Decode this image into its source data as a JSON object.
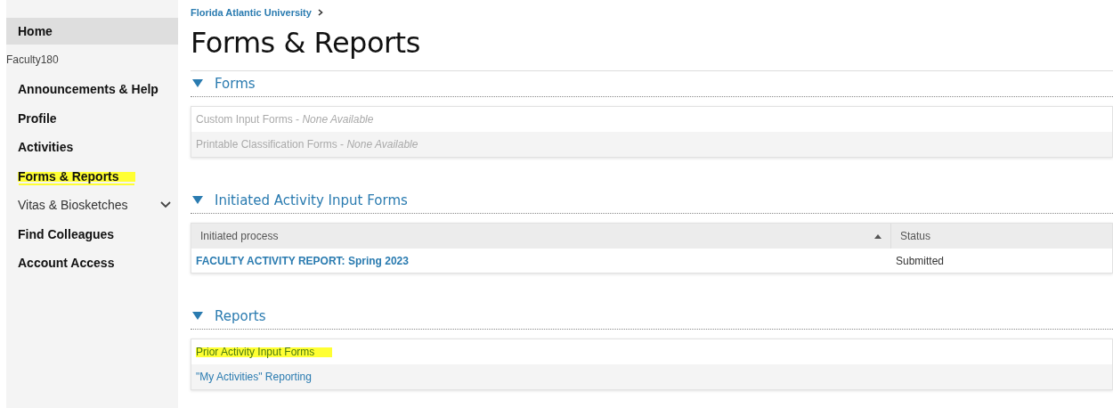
{
  "sidebar": {
    "items": [
      {
        "kind": "link",
        "label": "Home",
        "selected": true,
        "highlighted": false
      },
      {
        "kind": "heading",
        "label": "Faculty180"
      },
      {
        "kind": "link",
        "label": "Announcements & Help",
        "selected": false,
        "highlighted": false
      },
      {
        "kind": "link",
        "label": "Profile",
        "selected": false,
        "highlighted": false
      },
      {
        "kind": "link",
        "label": "Activities",
        "selected": false,
        "highlighted": false
      },
      {
        "kind": "link",
        "label": "Forms & Reports",
        "selected": false,
        "highlighted": true
      },
      {
        "kind": "group",
        "label": "Vitas & Biosketches",
        "selected": false,
        "highlighted": false,
        "expanded": false
      },
      {
        "kind": "link",
        "label": "Find Colleagues",
        "selected": false,
        "highlighted": false
      },
      {
        "kind": "link",
        "label": "Account Access",
        "selected": false,
        "highlighted": false
      }
    ]
  },
  "breadcrumb": [
    "Florida Atlantic University"
  ],
  "page_title": "Forms & Reports",
  "sections": [
    {
      "kind": "list",
      "title": "Forms",
      "expanded": true,
      "items": [
        {
          "label": "Custom Input Forms - *None Available*",
          "disabled": true,
          "highlighted": false
        },
        {
          "label": "Printable Classification Forms - *None Available*",
          "disabled": true,
          "highlighted": false
        }
      ]
    },
    {
      "kind": "table",
      "title": "Initiated Activity Input Forms",
      "expanded": true,
      "columns": [
        {
          "label": "Initiated process",
          "sorted": true
        },
        {
          "label": "Status",
          "sorted": false
        }
      ],
      "rows": [
        [
          "FACULTY ACTIVITY REPORT: Spring 2023",
          "Submitted"
        ]
      ]
    },
    {
      "kind": "list",
      "title": "Reports",
      "expanded": true,
      "items": [
        {
          "label": "Prior Activity Input Forms",
          "disabled": false,
          "highlighted": true
        },
        {
          "label": "\"My Activities\" Reporting",
          "disabled": false,
          "highlighted": false
        }
      ]
    }
  ]
}
